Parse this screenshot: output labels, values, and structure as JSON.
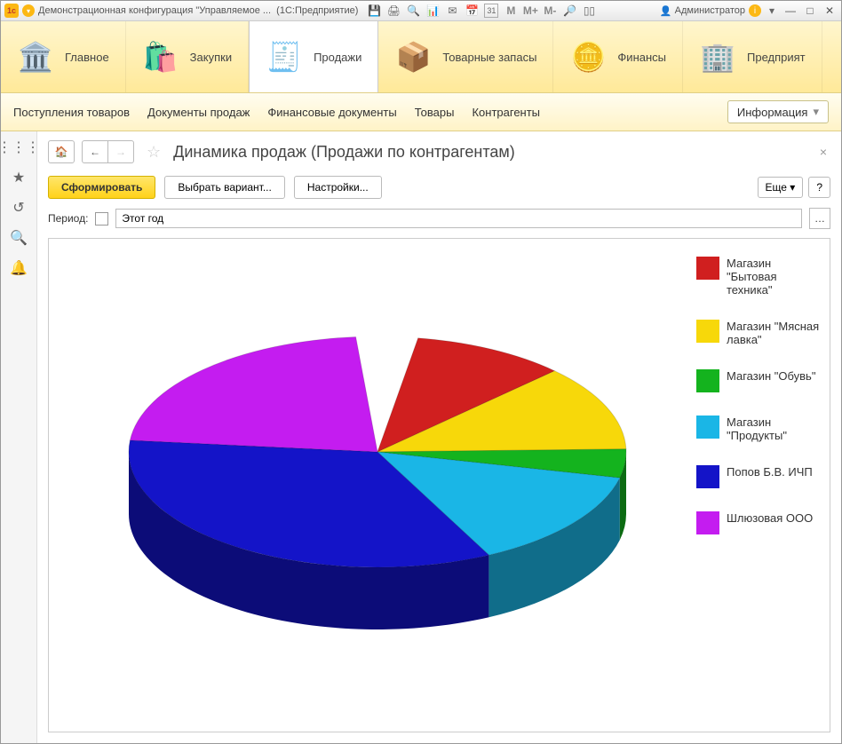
{
  "titlebar": {
    "app": "Демонстрационная конфигурация \"Управляемое ...",
    "suffix": "(1С:Предприятие)",
    "user": "Администратор",
    "calendar_day": "31"
  },
  "mainnav": [
    {
      "label": "Главное",
      "icon": "🏛️"
    },
    {
      "label": "Закупки",
      "icon": "🛍️"
    },
    {
      "label": "Продажи",
      "icon": "🧾",
      "active": true
    },
    {
      "label": "Товарные запасы",
      "icon": "📦"
    },
    {
      "label": "Финансы",
      "icon": "🪙"
    },
    {
      "label": "Предприят",
      "icon": "🏢"
    }
  ],
  "subnav": {
    "items": [
      "Поступления товаров",
      "Документы продаж",
      "Финансовые документы",
      "Товары",
      "Контрагенты"
    ],
    "info": "Информация"
  },
  "page": {
    "title": "Динамика продаж (Продажи по контрагентам)",
    "btn_form": "Сформировать",
    "btn_variant": "Выбрать вариант...",
    "btn_settings": "Настройки...",
    "btn_more": "Еще",
    "period_label": "Период:",
    "period_value": "Этот год"
  },
  "chart_data": {
    "type": "pie",
    "title": "",
    "series": [
      {
        "name": "Магазин \"Бытовая техника\"",
        "value": 10,
        "color": "#d01f1f"
      },
      {
        "name": "Магазин \"Мясная лавка\"",
        "value": 12,
        "color": "#f7d80a"
      },
      {
        "name": "Магазин \"Обувь\"",
        "value": 4,
        "color": "#14b31e"
      },
      {
        "name": "Магазин \"Продукты\"",
        "value": 14,
        "color": "#1ab6e6"
      },
      {
        "name": "Попов Б.В. ИЧП",
        "value": 34,
        "color": "#1414c8"
      },
      {
        "name": "Шлюзовая ООО",
        "value": 22,
        "color": "#c41cf0"
      }
    ],
    "gap_percent": 4
  }
}
